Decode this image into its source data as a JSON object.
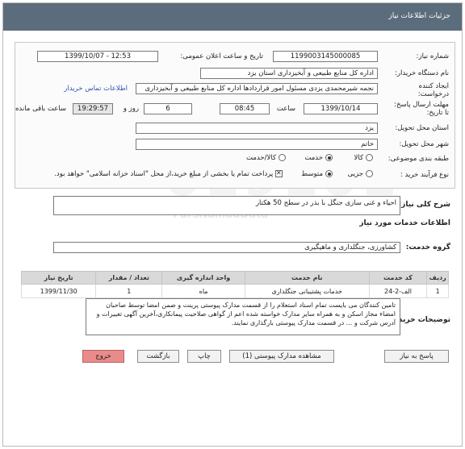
{
  "header": {
    "title": "جزئیات اطلاعات نیاز"
  },
  "form": {
    "need_number_label": "شماره نیاز:",
    "need_number": "1199003145000085",
    "announce_label": "تاریخ و ساعت اعلان عمومی:",
    "announce_value": "1399/10/07 - 12:53",
    "buyer_label": "نام دستگاه خریدار:",
    "buyer_value": "اداره کل منابع طبیعی و آبخیزداری استان یزد",
    "creator_label_1": "ایجاد کننده",
    "creator_label_2": "درخواست:",
    "creator_value": "نجمه شیرمحمدی یزدی مسئول امور قراردادها  اداره کل منابع طبیعی و آبخیزداری",
    "contact_link": "اطلاعات تماس خریدار",
    "deadline_label_1": "مهلت ارسال پاسخ:",
    "deadline_label_2": "تا تاریخ:",
    "deadline_date": "1399/10/14",
    "time_label": "ساعت",
    "deadline_time": "08:45",
    "days_value": "6",
    "days_label": "روز و",
    "remaining_time": "19:29:57",
    "remaining_label": "ساعت باقی مانده",
    "province_label": "استان محل تحویل:",
    "province_value": "یزد",
    "city_label": "شهر محل تحویل:",
    "city_value": "خاتم",
    "category_label": "طبقه بندی موضوعی:",
    "category_options": [
      "کالا",
      "خدمت",
      "کالا/خدمت"
    ],
    "category_selected": "خدمت",
    "purchase_type_label": "نوع فرآیند خرید :",
    "purchase_options": [
      "جزیی",
      "متوسط"
    ],
    "purchase_selected": "متوسط",
    "payment_note": "پرداخت تمام یا بخشی از مبلغ خرید،از محل \"اسناد خزانه اسلامی\" خواهد بود."
  },
  "summary": {
    "label": "شرح کلی نیاز:",
    "value": "احیاء و غنی سازی جنگل با بذر  در سطح 50 هکتار"
  },
  "services": {
    "section_title": "اطلاعات خدمات مورد نیاز",
    "group_label": "گروه خدمت:",
    "group_value": "کشاورزی، جنگلداری و ماهیگیری",
    "columns": [
      "ردیف",
      "کد خدمت",
      "نام خدمت",
      "واحد اندازه گیری",
      "تعداد / مقدار",
      "تاریخ نیاز"
    ],
    "rows": [
      [
        "1",
        "الف-2-24",
        "خدمات پشتیبانی جنگلداری",
        "ماه",
        "1",
        "1399/11/30"
      ]
    ]
  },
  "buyer_notes": {
    "label": "توضیحات خریدار:",
    "value": "تامین کنندگان می بایست تمام اسناد استعلام را از قسمت مدارک پیوستی پرینت و ضمن امضا توسط صاحبان امضاء مجاز اسکن و به همراه سایر مدارک خواسته شده اعم از گواهی صلاحیت پیمانکاری،آخرین آگهی تغییرات و آدرس شرکت و ... در قسمت مدارک پیوستی بارگذاری نمایند."
  },
  "buttons": {
    "reply": "پاسخ به نیاز",
    "attachments": "مشاهده مدارک پیوستی (1)",
    "print": "چاپ",
    "back": "بازگشت",
    "exit": "خروج"
  }
}
